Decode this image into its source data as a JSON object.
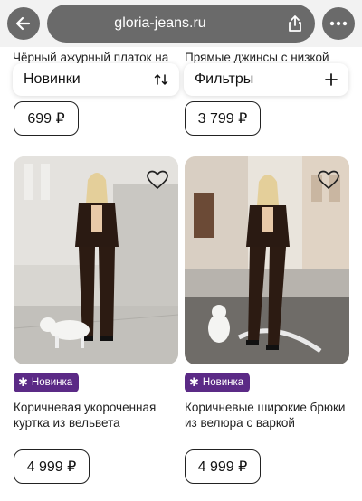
{
  "browser": {
    "url": "gloria-jeans.ru",
    "back_icon": "arrow-left-icon",
    "share_icon": "share-icon",
    "more_icon": "ellipsis-icon"
  },
  "toolbar": {
    "sort_label": "Новинки",
    "sort_icon": "sort-arrows-icon",
    "filter_label": "Фильтры",
    "filter_icon": "plus-icon"
  },
  "top_products": [
    {
      "name": "Чёрный ажурный платок на",
      "price": "699 ₽"
    },
    {
      "name": "Прямые джинсы с низкой",
      "price": "3 799 ₽"
    }
  ],
  "products": [
    {
      "badge": "Новинка",
      "name_line1": "Коричневая укороченная",
      "name_line2": "куртка из вельвета",
      "price": "4 999 ₽"
    },
    {
      "badge": "Новинка",
      "name_line1": "Коричневые широкие брюки",
      "name_line2": "из велюра с варкой",
      "price": "4 999 ₽"
    }
  ],
  "colors": {
    "badge": "#5b2a86",
    "chrome": "#6a6a6a"
  }
}
